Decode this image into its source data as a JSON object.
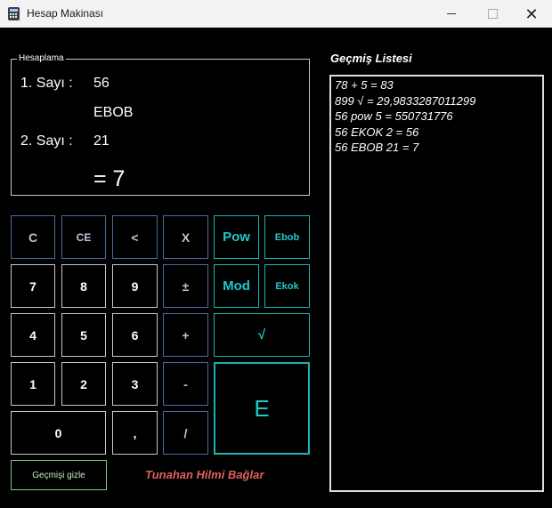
{
  "window": {
    "title": "Hesap Makinası",
    "minimize_icon": "minimize-icon",
    "maximize_icon": "maximize-icon",
    "close_icon": "close-x"
  },
  "calc": {
    "group_title": "Hesaplama",
    "first_label": "1. Sayı :",
    "first_value": "56",
    "operation": "EBOB",
    "second_label": "2. Sayı :",
    "second_value": "21",
    "result": "= 7"
  },
  "buttons": {
    "c": "C",
    "ce": "CE",
    "back": "<",
    "multiply": "X",
    "pow": "Pow",
    "ebob": "Ebob",
    "n7": "7",
    "n8": "8",
    "n9": "9",
    "plusminus": "±",
    "mod": "Mod",
    "ekok": "Ekok",
    "n4": "4",
    "n5": "5",
    "n6": "6",
    "plus": "+",
    "sqrt": "√",
    "n1": "1",
    "n2": "2",
    "n3": "3",
    "minus": "-",
    "equals": "E",
    "n0": "0",
    "comma": ",",
    "divide": "/"
  },
  "footer": {
    "hide_history": "Geçmişi gizle",
    "author": "Tunahan Hilmi Bağlar"
  },
  "history": {
    "title": "Geçmiş Listesi",
    "items": [
      "78 + 5 = 83",
      "899 √ = 29,9833287011299",
      "56 pow 5 = 550731776",
      "56 EKOK 2 = 56",
      "56 EBOB 21 = 7"
    ]
  },
  "colors": {
    "accent_cyan": "#1ec9c9",
    "author_red": "#e0605a",
    "hide_green": "#7cc97c",
    "op_border": "#4a6b9a"
  }
}
